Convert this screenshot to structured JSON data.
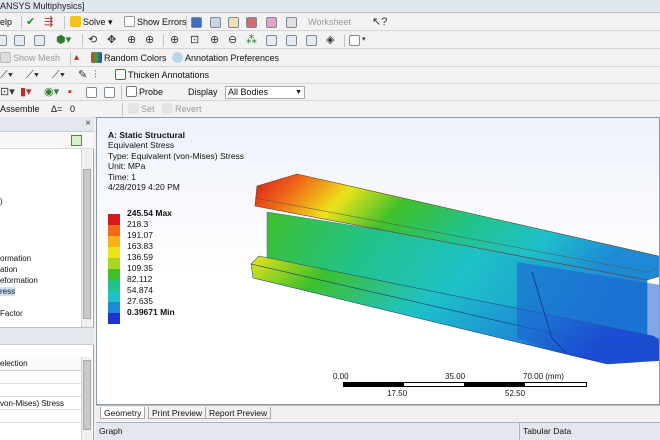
{
  "window": {
    "title": "ANSYS Multiphysics]"
  },
  "toolbar1": {
    "help_menu": "elp",
    "solve": "Solve",
    "show_errors": "Show Errors",
    "worksheet": "Worksheet"
  },
  "toolbar3": {
    "show_mesh": "Show Mesh",
    "random_colors": "Random Colors",
    "annotation_preferences": "Annotation Preferences"
  },
  "toolbar4": {
    "thicken_annotations": "Thicken Annotations"
  },
  "toolbar5": {
    "probe": "Probe",
    "display_label": "Display",
    "display_value": "All Bodies"
  },
  "toolbar6": {
    "assemble": "Assemble",
    "delta_value": "0",
    "set": "Set",
    "revert": "Revert"
  },
  "tree": {
    "items": [
      ")",
      "ormation",
      "ation",
      "eformation",
      "ress",
      "Factor"
    ],
    "selected_index": 4
  },
  "details": {
    "header": "election",
    "rows": [
      "",
      "",
      "von-Mises) Stress",
      ""
    ]
  },
  "result": {
    "title": "A: Static Structural",
    "name": "Equivalent Stress",
    "type": "Type: Equivalent (von-Mises) Stress",
    "unit": "Unit: MPa",
    "time": "Time: 1",
    "date": "4/28/2019 4:20 PM"
  },
  "legend": {
    "max_label": "245.54 Max",
    "values": [
      "218.3",
      "191.07",
      "163.83",
      "136.59",
      "109.35",
      "82.112",
      "54.874",
      "27.635"
    ],
    "min_label": "0.39671 Min",
    "colors": [
      "#d7191c",
      "#f06a17",
      "#f8b21b",
      "#ebe41b",
      "#a8d624",
      "#3fc02b",
      "#22c28a",
      "#1ec1c8",
      "#1e8ad6",
      "#1b35d1"
    ]
  },
  "scale": {
    "top_labels": [
      "0.00",
      "35.00",
      "70.00 (mm)"
    ],
    "bottom_labels": [
      "17.50",
      "52.50"
    ]
  },
  "tabs": [
    "Geometry",
    "Print Preview",
    "Report Preview"
  ],
  "bottom": {
    "graph": "Graph",
    "tabular": "Tabular Data"
  }
}
